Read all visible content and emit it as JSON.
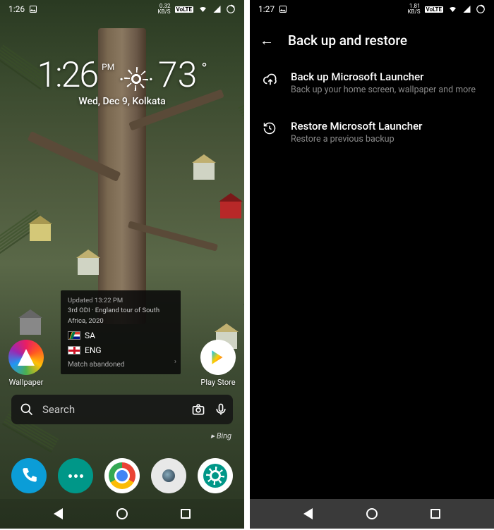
{
  "phone1": {
    "status": {
      "time": "1:26",
      "kbs_value": "0.32",
      "kbs_unit": "KB/S",
      "volte": "VoLTE"
    },
    "clock": {
      "time": "1:26",
      "ampm": "PM",
      "temp": "73",
      "sub": "Wed, Dec 9, Kolkata"
    },
    "card": {
      "updated": "Updated 13:22 PM",
      "title": "3rd ODI · England tour of South Africa, 2020",
      "team1": "SA",
      "team2": "ENG",
      "status": "Match abandoned"
    },
    "apps": {
      "wallpaper": "Wallpaper",
      "playstore": "Play Store"
    },
    "search": {
      "placeholder": "Search"
    },
    "bing": "▸ Bing"
  },
  "phone2": {
    "status": {
      "time": "1:27",
      "kbs_value": "1.81",
      "kbs_unit": "KB/S",
      "volte": "VoLTE"
    },
    "appbar": {
      "title": "Back up and restore"
    },
    "items": [
      {
        "title": "Back up Microsoft Launcher",
        "sub": "Back up your home screen, wallpaper and more"
      },
      {
        "title": "Restore Microsoft Launcher",
        "sub": "Restore a previous backup"
      }
    ]
  }
}
